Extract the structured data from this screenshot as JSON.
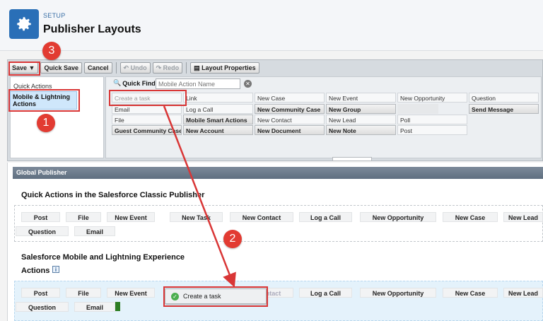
{
  "header": {
    "section": "SETUP",
    "title": "Publisher Layouts",
    "icon": "gear-icon",
    "accent": "#2a6fb7"
  },
  "toolbar": {
    "save": "Save",
    "quick_save": "Quick Save",
    "cancel": "Cancel",
    "undo": "Undo",
    "redo": "Redo",
    "layout_properties": "Layout Properties"
  },
  "left_panel": {
    "quick_actions": "Quick Actions",
    "mobile_lightning": "Mobile & Lightning Actions"
  },
  "quick_find": {
    "label": "Quick Find",
    "placeholder": "Mobile Action Name"
  },
  "palette": [
    [
      "Create a task",
      "Link",
      "New Case",
      "New Event",
      "New Opportunity",
      "Question"
    ],
    [
      "Email",
      "Log a Call",
      "New Community Case",
      "New Group",
      "",
      "Send Message"
    ],
    [
      "File",
      "Mobile Smart Actions",
      "New Contact",
      "New Lead",
      "Poll",
      ""
    ],
    [
      "Guest Community Case",
      "New Account",
      "New Document",
      "New Note",
      "Post",
      ""
    ]
  ],
  "global_publisher": "Global Publisher",
  "classic": {
    "title": "Quick Actions in the Salesforce Classic Publisher",
    "row1": [
      "Post",
      "File",
      "New Event",
      "New Task",
      "New Contact",
      "Log a Call",
      "New Opportunity",
      "New Case",
      "New Lead"
    ],
    "row2": [
      "Question",
      "Email"
    ]
  },
  "mobile": {
    "title": "Salesforce Mobile and Lightning Experience",
    "title2": "Actions",
    "row1": [
      "Post",
      "File",
      "New Event",
      "New Contact",
      "Log a Call",
      "New Opportunity",
      "New Case",
      "New Lead"
    ],
    "row2": [
      "Question",
      "Email"
    ]
  },
  "drag_item": "Create a task",
  "badges": [
    "1",
    "2",
    "3"
  ],
  "annotation_color": "#d93636"
}
